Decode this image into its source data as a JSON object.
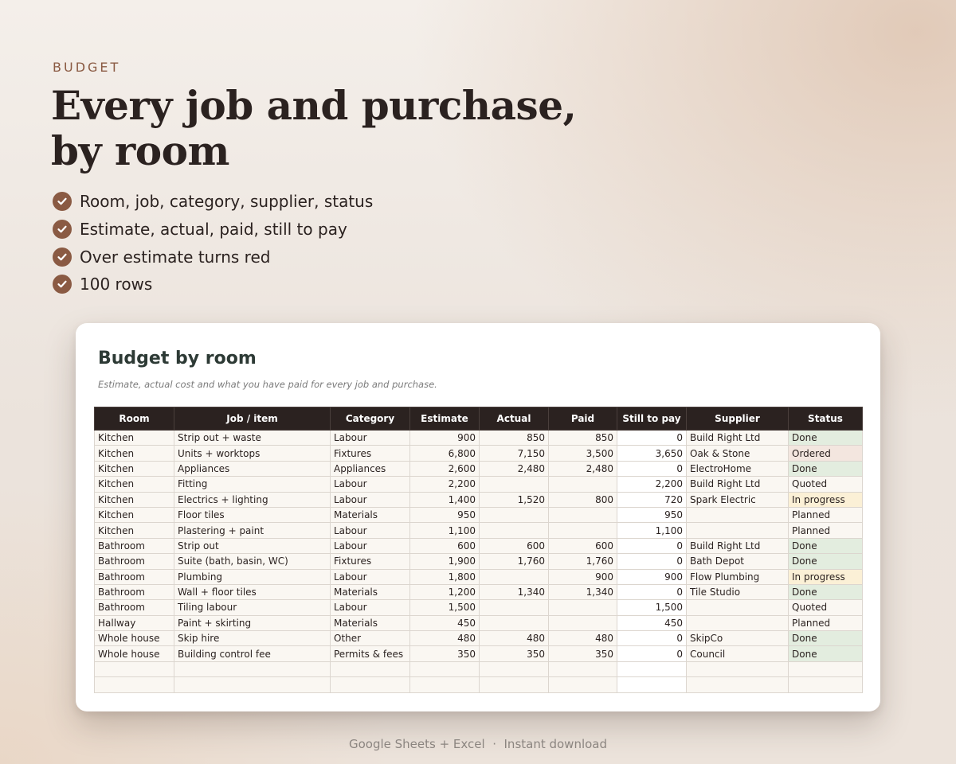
{
  "header": {
    "eyebrow": "BUDGET",
    "headline_line1": "Every job and purchase,",
    "headline_line2": "by room"
  },
  "features": [
    "Room, job, category, supplier, status",
    "Estimate, actual, paid, still to pay",
    "Over estimate turns red",
    "100 rows"
  ],
  "sheet": {
    "title": "Budget by room",
    "subtitle": "Estimate, actual cost and what you have paid for every job and purchase.",
    "columns": [
      "Room",
      "Job / item",
      "Category",
      "Estimate",
      "Actual",
      "Paid",
      "Still to pay",
      "Supplier",
      "Status"
    ],
    "rows": [
      [
        "Kitchen",
        "Strip out + waste",
        "Labour",
        "900",
        "850",
        "850",
        "0",
        "Build Right Ltd",
        "Done"
      ],
      [
        "Kitchen",
        "Units + worktops",
        "Fixtures",
        "6,800",
        "7,150",
        "3,500",
        "3,650",
        "Oak & Stone",
        "Ordered"
      ],
      [
        "Kitchen",
        "Appliances",
        "Appliances",
        "2,600",
        "2,480",
        "2,480",
        "0",
        "ElectroHome",
        "Done"
      ],
      [
        "Kitchen",
        "Fitting",
        "Labour",
        "2,200",
        "",
        "",
        "2,200",
        "Build Right Ltd",
        "Quoted"
      ],
      [
        "Kitchen",
        "Electrics + lighting",
        "Labour",
        "1,400",
        "1,520",
        "800",
        "720",
        "Spark Electric",
        "In progress"
      ],
      [
        "Kitchen",
        "Floor tiles",
        "Materials",
        "950",
        "",
        "",
        "950",
        "",
        "Planned"
      ],
      [
        "Kitchen",
        "Plastering + paint",
        "Labour",
        "1,100",
        "",
        "",
        "1,100",
        "",
        "Planned"
      ],
      [
        "Bathroom",
        "Strip out",
        "Labour",
        "600",
        "600",
        "600",
        "0",
        "Build Right Ltd",
        "Done"
      ],
      [
        "Bathroom",
        "Suite (bath, basin, WC)",
        "Fixtures",
        "1,900",
        "1,760",
        "1,760",
        "0",
        "Bath Depot",
        "Done"
      ],
      [
        "Bathroom",
        "Plumbing",
        "Labour",
        "1,800",
        "",
        "900",
        "900",
        "Flow Plumbing",
        "In progress"
      ],
      [
        "Bathroom",
        "Wall + floor tiles",
        "Materials",
        "1,200",
        "1,340",
        "1,340",
        "0",
        "Tile Studio",
        "Done"
      ],
      [
        "Bathroom",
        "Tiling labour",
        "Labour",
        "1,500",
        "",
        "",
        "1,500",
        "",
        "Quoted"
      ],
      [
        "Hallway",
        "Paint + skirting",
        "Materials",
        "450",
        "",
        "",
        "450",
        "",
        "Planned"
      ],
      [
        "Whole house",
        "Skip hire",
        "Other",
        "480",
        "480",
        "480",
        "0",
        "SkipCo",
        "Done"
      ],
      [
        "Whole house",
        "Building control fee",
        "Permits & fees",
        "350",
        "350",
        "350",
        "0",
        "Council",
        "Done"
      ],
      [
        "",
        "",
        "",
        "",
        "",
        "",
        "",
        "",
        ""
      ],
      [
        "",
        "",
        "",
        "",
        "",
        "",
        "",
        "",
        ""
      ]
    ]
  },
  "status_colors": {
    "Done": "#e3eddf",
    "Ordered": "#f3e6df",
    "In progress": "#fbf0d6"
  },
  "footer": "Google Sheets + Excel  ·  Instant download",
  "icons": {
    "feature_bullet": "check-circle-icon"
  }
}
